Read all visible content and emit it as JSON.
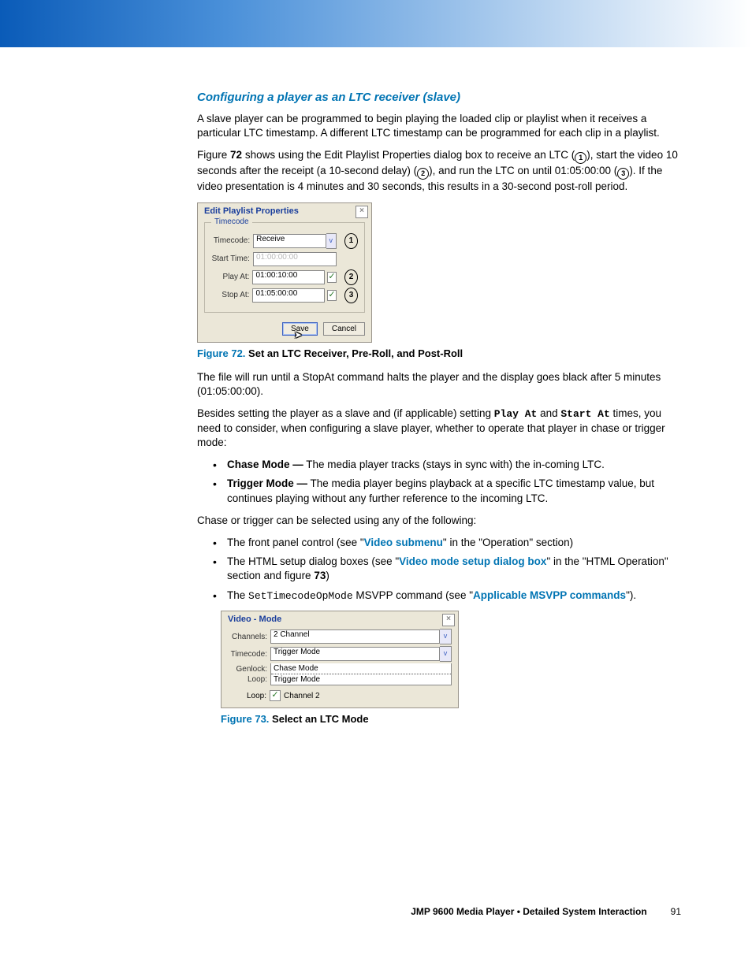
{
  "heading": "Configuring a player as an LTC receiver (slave)",
  "p1": "A slave player can be programmed to begin playing the loaded clip or playlist when it receives a particular LTC timestamp. A different LTC timestamp can be programmed for each clip in a playlist.",
  "p2a": "Figure ",
  "p2_fignum": "72",
  "p2b": " shows using the Edit Playlist Properties dialog box to receive an LTC (",
  "p2c": "), start the video 10 seconds after the receipt (a 10-second delay) (",
  "p2d": "), and run the LTC on until 01:05:00:00 (",
  "p2e": "). If the video presentation is 4 minutes and 30 seconds, this results in a 30-second post-roll period.",
  "circled": {
    "n1": "1",
    "n2": "2",
    "n3": "3"
  },
  "dialog1": {
    "title": "Edit Playlist Properties",
    "fieldset_legend": "Timecode",
    "rows": {
      "timecode_label": "Timecode:",
      "timecode_value": "Receive",
      "start_label": "Start Time:",
      "start_value": "01:00:00:00",
      "play_label": "Play At:",
      "play_value": "01:00:10:00",
      "stop_label": "Stop At:",
      "stop_value": "01:05:00:00"
    },
    "buttons": {
      "save": "Save",
      "cancel": "Cancel"
    }
  },
  "fig72": {
    "label": "Figure 72.",
    "title": "Set an LTC Receiver, Pre-Roll, and Post-Roll"
  },
  "p3": "The file will run until a StopAt command halts the player and the display goes black after 5 minutes (01:05:00:00).",
  "p4a": "Besides setting the player as a slave and (if applicable) setting ",
  "p4_playat": "Play At",
  "p4b": " and ",
  "p4_startat": "Start At",
  "p4c": " times, you need to consider, when configuring a slave player, whether to operate that player in chase or trigger mode:",
  "bullets1": {
    "b1_bold": "Chase Mode —",
    "b1_text": " The media player tracks (stays in sync with) the in-coming LTC.",
    "b2_bold": "Trigger Mode —",
    "b2_text": " The media player begins playback at a specific LTC timestamp value, but continues playing without any further reference to the incoming LTC."
  },
  "p5": "Chase or trigger can be selected using any of the following:",
  "bullets2": {
    "b1a": "The front panel control (see \"",
    "b1_link": "Video submenu",
    "b1b": "\" in the \"Operation\" section)",
    "b2a": "The HTML setup dialog boxes (see \"",
    "b2_link": "Video mode setup dialog box",
    "b2b": "\" in the \"HTML Operation\" section and figure ",
    "b2_fig": "73",
    "b2c": ")",
    "b3a": "The ",
    "b3_mono": "SetTimecodeOpMode",
    "b3b": " MSVPP command (see \"",
    "b3_link": "Applicable MSVPP commands",
    "b3c": "\")."
  },
  "dialog2": {
    "title": "Video - Mode",
    "channels_label": "Channels:",
    "channels_value": "2 Channel",
    "timecode_label": "Timecode:",
    "timecode_value": "Trigger Mode",
    "genlock_label": "Genlock:",
    "loop_label": "Loop:",
    "opt_chase": "Chase Mode",
    "opt_trigger": "Trigger Mode",
    "loop2_prefix": "Loop:",
    "loop2_text": "Channel 2"
  },
  "fig73": {
    "label": "Figure 73.",
    "title": "Select an LTC Mode"
  },
  "footer": {
    "product": "JMP 9600 Media Player • Detailed System Interaction",
    "page": "91"
  }
}
